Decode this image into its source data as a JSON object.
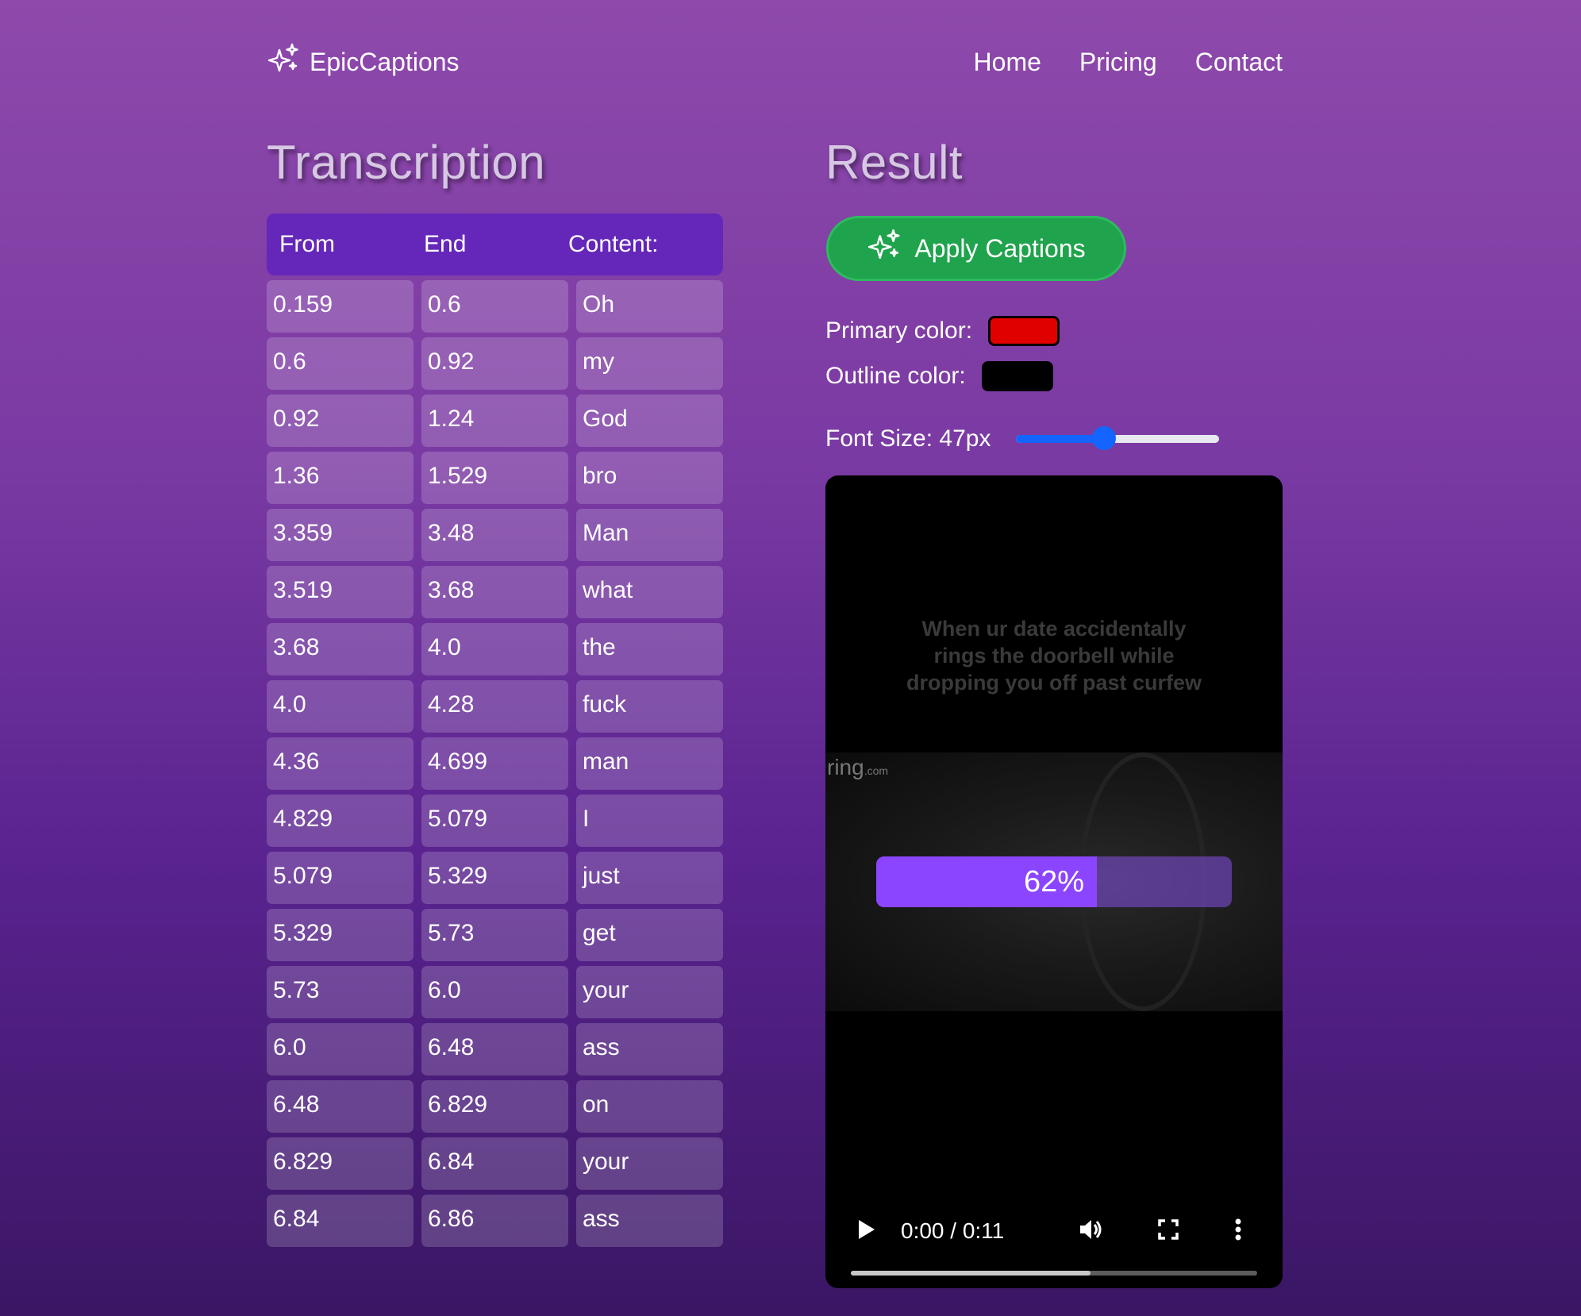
{
  "nav": {
    "brand": "EpicCaptions",
    "links": [
      "Home",
      "Pricing",
      "Contact"
    ]
  },
  "transcription": {
    "title": "Transcription",
    "headers": [
      "From",
      "End",
      "Content:"
    ],
    "rows": [
      [
        "0.159",
        "0.6",
        "Oh"
      ],
      [
        "0.6",
        "0.92",
        "my"
      ],
      [
        "0.92",
        "1.24",
        "God"
      ],
      [
        "1.36",
        "1.529",
        "bro"
      ],
      [
        "3.359",
        "3.48",
        "Man"
      ],
      [
        "3.519",
        "3.68",
        "what"
      ],
      [
        "3.68",
        "4.0",
        "the"
      ],
      [
        "4.0",
        "4.28",
        "fuck"
      ],
      [
        "4.36",
        "4.699",
        "man"
      ],
      [
        "4.829",
        "5.079",
        "I"
      ],
      [
        "5.079",
        "5.329",
        "just"
      ],
      [
        "5.329",
        "5.73",
        "get"
      ],
      [
        "5.73",
        "6.0",
        "your"
      ],
      [
        "6.0",
        "6.48",
        "ass"
      ],
      [
        "6.48",
        "6.829",
        "on"
      ],
      [
        "6.829",
        "6.84",
        "your"
      ],
      [
        "6.84",
        "6.86",
        "ass"
      ]
    ]
  },
  "result": {
    "title": "Result",
    "apply_label": "Apply Captions",
    "primary_label": "Primary color:",
    "primary_color": "#e10000",
    "outline_label": "Outline color:",
    "outline_color": "#000000",
    "font_size_label": "Font Size: 47px",
    "font_size_slider_fraction": 0.43
  },
  "video": {
    "caption_text": "When ur date accidentally rings the doorbell while dropping you off past curfew",
    "watermark": "ring",
    "watermark_suffix": ".com",
    "progress_label": "62%",
    "progress_fraction": 0.62,
    "time": "0:00 / 0:11",
    "buffered_fraction": 0.59
  },
  "icons": {
    "brand": "sparkles-icon",
    "apply": "sparkles-icon",
    "play": "play-icon",
    "volume": "volume-icon",
    "fullscreen": "fullscreen-icon",
    "more": "more-vertical-icon"
  }
}
